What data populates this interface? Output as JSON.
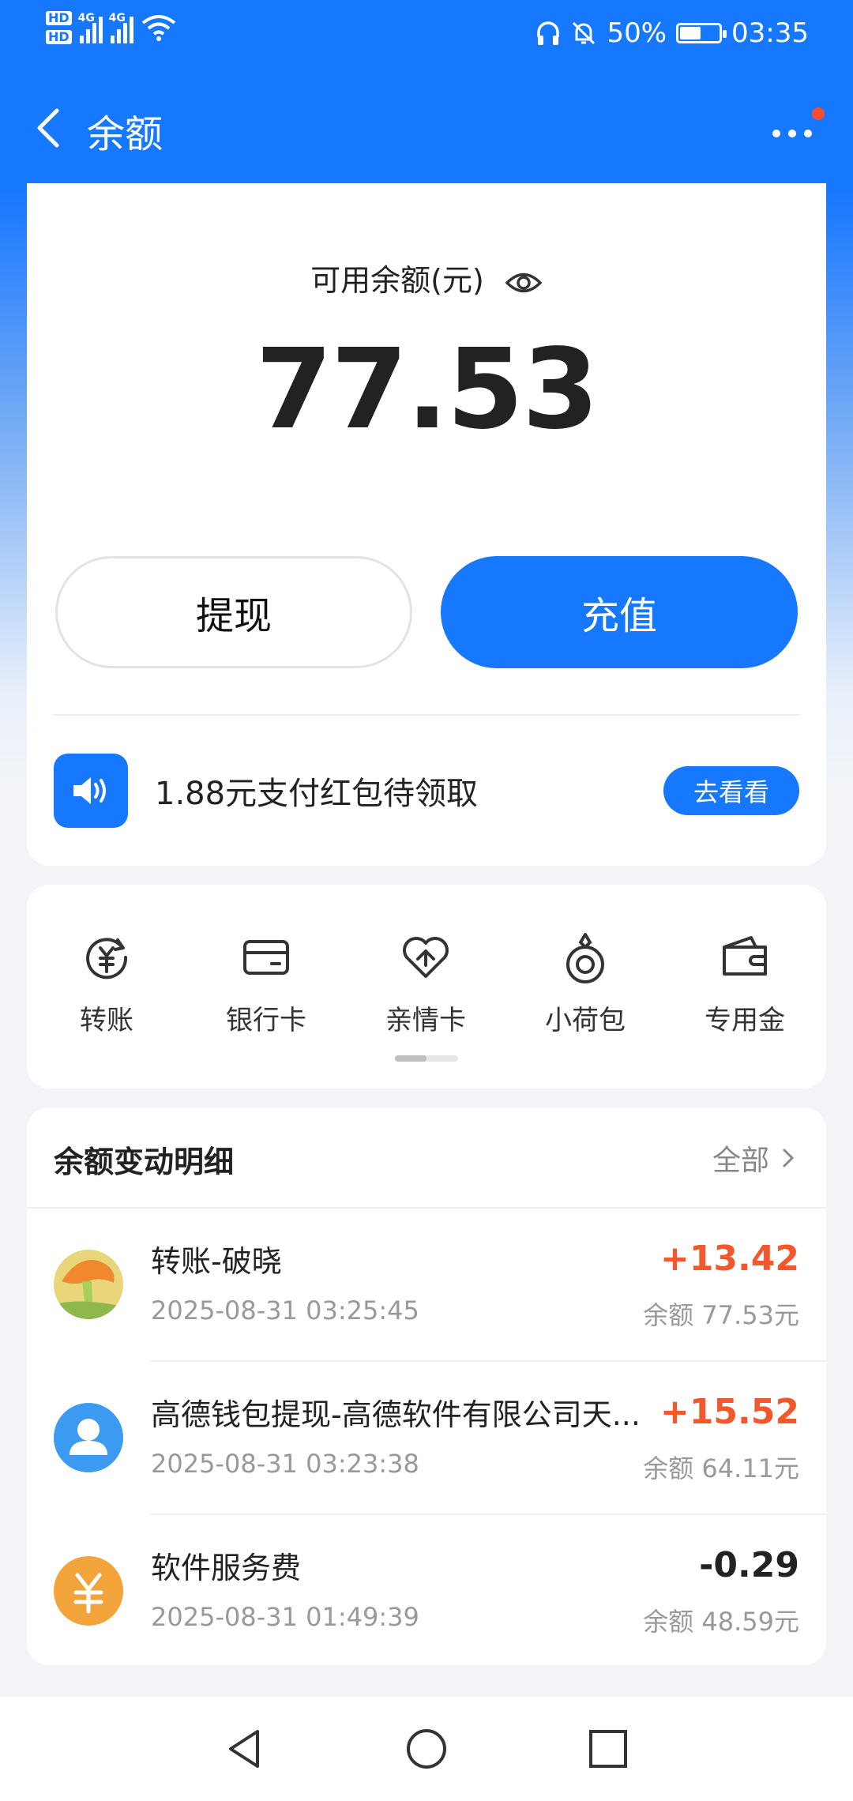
{
  "status_bar": {
    "hd1": "HD",
    "hd2": "HD",
    "net1": "4G",
    "net2": "4G",
    "battery_percent": "50%",
    "time": "03:35"
  },
  "header": {
    "title": "余额"
  },
  "balance": {
    "label": "可用余额(元)",
    "amount": "77.53",
    "withdraw_label": "提现",
    "recharge_label": "充值"
  },
  "promo": {
    "text": "1.88元支付红包待领取",
    "button_label": "去看看"
  },
  "services": [
    {
      "label": "转账",
      "icon": "transfer-yuan-icon"
    },
    {
      "label": "银行卡",
      "icon": "bank-card-icon"
    },
    {
      "label": "亲情卡",
      "icon": "family-card-heart-icon"
    },
    {
      "label": "小荷包",
      "icon": "small-pouch-icon"
    },
    {
      "label": "专用金",
      "icon": "wallet-icon"
    }
  ],
  "details": {
    "title": "余额变动明细",
    "all_label": "全部",
    "rows": [
      {
        "name": "转账-破晓",
        "time": "2025-08-31 03:25:45",
        "amount": "+13.42",
        "balance": "余额 77.53元",
        "avatar": "photo-avatar"
      },
      {
        "name": "高德钱包提现-高德软件有限公司天...",
        "time": "2025-08-31 03:23:38",
        "amount": "+15.52",
        "balance": "余额 64.11元",
        "avatar": "default-user-avatar"
      },
      {
        "name": "软件服务费",
        "time": "2025-08-31 01:49:39",
        "amount": "-0.29",
        "balance": "余额 48.59元",
        "avatar": "yuan-coin-avatar"
      }
    ]
  },
  "colors": {
    "primary": "#1677ff",
    "positive": "#f2582d",
    "coin": "#f2a43a"
  }
}
